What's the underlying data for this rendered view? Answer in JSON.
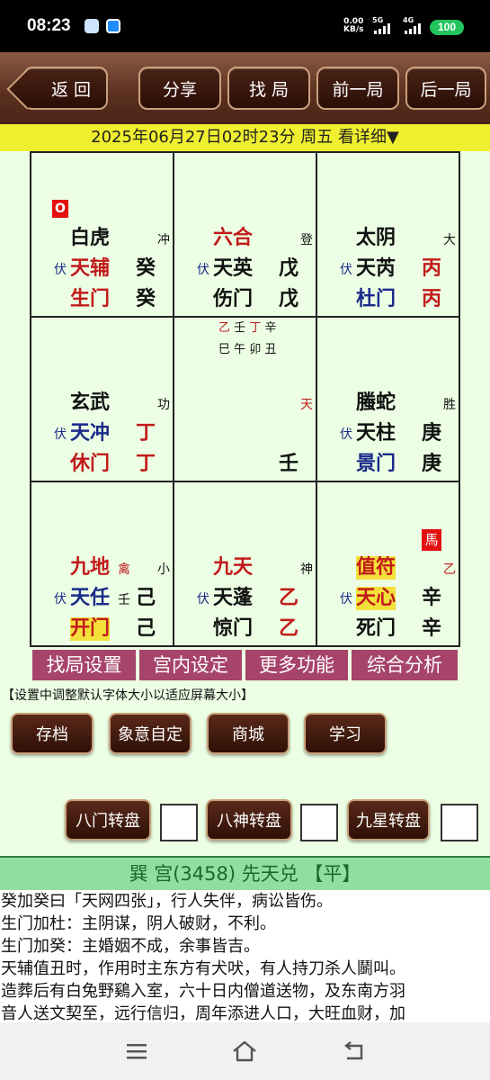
{
  "status": {
    "time": "08:23",
    "net_speed": "0.00",
    "net_unit": "KB/s",
    "sig1": "5G",
    "sig2": "4G",
    "battery": "100"
  },
  "toolbar": {
    "back": "返 回",
    "share": "分享",
    "find": "找 局",
    "prev": "前一局",
    "next": "后一局"
  },
  "datebar": "2025年06月27日02时23分 周五 看详细▼",
  "board": {
    "c0": {
      "badge": "O",
      "god": "白虎",
      "tag": "冲",
      "fu": "伏",
      "star": "天辅",
      "stem1": "癸",
      "door": "生门",
      "stem2": "癸"
    },
    "c1": {
      "god": "六合",
      "tag": "登",
      "fu": "伏",
      "star": "天英",
      "stem1": "戊",
      "door": "伤门",
      "stem2": "戊"
    },
    "c2": {
      "god": "太阴",
      "tag": "大",
      "fu": "伏",
      "star": "天芮",
      "stem1": "丙",
      "door": "杜门",
      "stem2": "丙"
    },
    "c3": {
      "god": "玄武",
      "tag": "功",
      "fu": "伏",
      "star": "天冲",
      "stem1": "丁",
      "door": "休门",
      "stem2": "丁"
    },
    "c4": {
      "pillars_top": [
        "乙",
        "壬",
        "丁",
        "辛"
      ],
      "pillars_bottom": [
        "巳",
        "午",
        "卯",
        "丑"
      ],
      "tag": "天",
      "stem2": "壬"
    },
    "c5": {
      "god": "螣蛇",
      "tag": "胜",
      "fu": "伏",
      "star": "天柱",
      "stem1": "庚",
      "door": "景门",
      "stem2": "庚"
    },
    "c6": {
      "god": "九地",
      "extra": "禽",
      "tag": "小",
      "fu": "伏",
      "star": "天任",
      "extra2": "壬",
      "stem1": "己",
      "door": "开门",
      "stem2": "己"
    },
    "c7": {
      "god": "九天",
      "tag": "神",
      "fu": "伏",
      "star": "天蓬",
      "stem1": "乙",
      "door": "惊门",
      "stem2": "乙"
    },
    "c8": {
      "badge": "馬",
      "god": "值符",
      "tag": "乙",
      "fu": "伏",
      "star": "天心",
      "stem1": "辛",
      "door": "死门",
      "stem2": "辛"
    }
  },
  "functions": [
    "找局设置",
    "宫内设定",
    "更多功能",
    "综合分析"
  ],
  "notice": "【设置中调整默认字体大小以适应屏幕大小】",
  "buttons_row1": [
    "存档",
    "象意自定",
    "商城",
    "学习"
  ],
  "turn_buttons": [
    "八门转盘",
    "八神转盘",
    "九星转盘"
  ],
  "info": {
    "title": "巽 宫(3458) 先天兑 【平】",
    "lines": [
      "癸加癸曰「天网四张」，行人失伴，病讼皆伤。",
      "生门加杜：主阴谋，阴人破财，不利。",
      "生门加癸：主婚姻不成，余事皆吉。",
      "天辅值丑时，作用时主东方有犬吠，有人持刀杀人鬬叫。",
      "造葬后有白兔野鷄入室，六十日内僧道送物，及东南方羽",
      "音人送文契至，远行信归，周年添进人口，大旺血财，加"
    ]
  },
  "colors": {
    "accent_brown": "#4a2216",
    "date_yellow": "#f0ef2f",
    "board_green": "#ecffe4",
    "func_purple": "#a6446a",
    "info_green": "#8fe0a0"
  }
}
